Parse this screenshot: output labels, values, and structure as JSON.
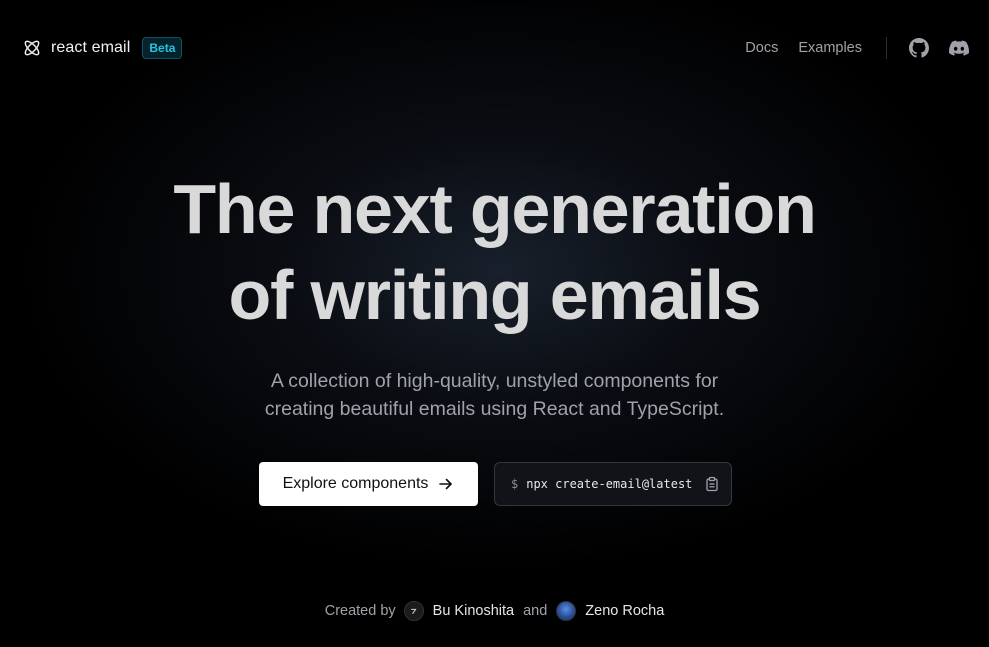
{
  "header": {
    "brand_name": "react email",
    "badge": "Beta",
    "nav": {
      "docs": "Docs",
      "examples": "Examples"
    },
    "icons": [
      "github-icon",
      "discord-icon"
    ]
  },
  "hero": {
    "title_line1": "The next generation",
    "title_line2": "of writing emails",
    "subtitle_line1": "A collection of high-quality, unstyled components for",
    "subtitle_line2": "creating beautiful emails using React and TypeScript."
  },
  "actions": {
    "explore_label": "Explore components",
    "command_prompt": "$",
    "command_text": "npx create-email@latest"
  },
  "credits": {
    "prefix": "Created by",
    "author1": "Bu Kinoshita",
    "conjunction": "and",
    "author2": "Zeno Rocha"
  },
  "colors": {
    "background": "#000000",
    "badge_accent": "#27c4e0",
    "muted_text": "#a1a1aa",
    "cta_background": "#ffffff"
  }
}
